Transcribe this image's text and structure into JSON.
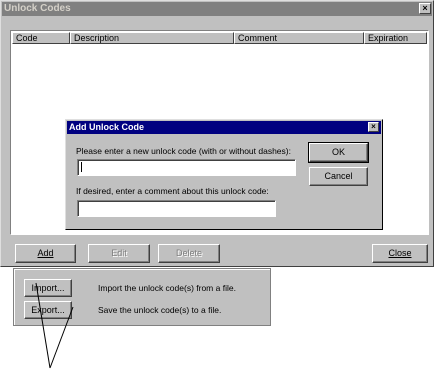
{
  "window": {
    "title": "Unlock Codes",
    "close_glyph": "×",
    "close_icon": "close-icon"
  },
  "list": {
    "columns": [
      "Code",
      "Description",
      "Comment",
      "Expiration"
    ],
    "rows": []
  },
  "main_buttons": {
    "add": "Add",
    "edit": "Edit",
    "delete": "Delete",
    "close": "Close"
  },
  "dialog": {
    "title": "Add Unlock Code",
    "close_glyph": "×",
    "prompt": "Please enter a new unlock code (with or without dashes):",
    "code_value": "",
    "comment_prompt": "If desired, enter a comment about this unlock code:",
    "comment_value": "",
    "ok": "OK",
    "cancel": "Cancel"
  },
  "transfer": {
    "import_button": "Import...",
    "import_desc": "Import the unlock code(s) from a file.",
    "export_button": "Export...",
    "export_desc": "Save the unlock code(s) to a file."
  }
}
